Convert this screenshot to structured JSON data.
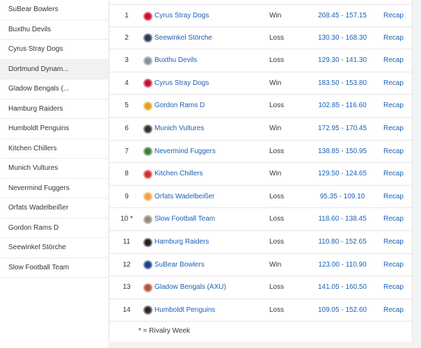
{
  "sidebar": {
    "items": [
      {
        "label": "SuBear Bowlers"
      },
      {
        "label": "Buxthu Devils"
      },
      {
        "label": "Cyrus Stray Dogs"
      },
      {
        "label": "Dortmund Dynam..."
      },
      {
        "label": "Gladow Bengals (..."
      },
      {
        "label": "Hamburg Raiders"
      },
      {
        "label": "Humboldt Penguins"
      },
      {
        "label": "Kitchen Chillers"
      },
      {
        "label": "Munich Vultures"
      },
      {
        "label": "Nevermind Fuggers"
      },
      {
        "label": "Orfats Wadelbeißer"
      },
      {
        "label": "Gordon Rams D"
      },
      {
        "label": "Seewinkel Störche"
      },
      {
        "label": "Slow Football Team"
      }
    ],
    "active_index": 3
  },
  "schedule": {
    "rows": [
      {
        "week": "1",
        "team": "Cyrus Stray Dogs",
        "result": "Win",
        "score": "208.45 - 157.15",
        "recap": "Recap",
        "logo_color": "#c8102e",
        "logo_icon": "cyrus-logo-icon"
      },
      {
        "week": "2",
        "team": "Seewinkel Störche",
        "result": "Loss",
        "score": "130.30 - 168.30",
        "recap": "Recap",
        "logo_color": "#2b3a55",
        "logo_icon": "seewinkel-logo-icon"
      },
      {
        "week": "3",
        "team": "Buxthu Devils",
        "result": "Loss",
        "score": "129.30 - 141.30",
        "recap": "Recap",
        "logo_color": "#8a8f99",
        "logo_icon": "buxthu-logo-icon"
      },
      {
        "week": "4",
        "team": "Cyrus Stray Dogs",
        "result": "Win",
        "score": "183.50 - 153.80",
        "recap": "Recap",
        "logo_color": "#c8102e",
        "logo_icon": "cyrus-logo-icon"
      },
      {
        "week": "5",
        "team": "Gordon Rams D",
        "result": "Loss",
        "score": "102.85 - 116.60",
        "recap": "Recap",
        "logo_color": "#e0a020",
        "logo_icon": "gordon-logo-icon"
      },
      {
        "week": "6",
        "team": "Munich Vultures",
        "result": "Win",
        "score": "172.95 - 170.45",
        "recap": "Recap",
        "logo_color": "#333333",
        "logo_icon": "munich-logo-icon"
      },
      {
        "week": "7",
        "team": "Nevermind Fuggers",
        "result": "Loss",
        "score": "138.85 - 150.95",
        "recap": "Recap",
        "logo_color": "#3f7d3a",
        "logo_icon": "nevermind-logo-icon"
      },
      {
        "week": "8",
        "team": "Kitchen Chillers",
        "result": "Win",
        "score": "129.50 - 124.65",
        "recap": "Recap",
        "logo_color": "#d22f2f",
        "logo_icon": "kitchen-logo-icon"
      },
      {
        "week": "9",
        "team": "Orfats Wadelbeißer",
        "result": "Loss",
        "score": "95.35 - 109.10",
        "recap": "Recap",
        "logo_color": "#f0a040",
        "logo_icon": "orfats-logo-icon"
      },
      {
        "week": "10 *",
        "team": "Slow Football Team",
        "result": "Loss",
        "score": "118.60 - 138.45",
        "recap": "Recap",
        "logo_color": "#9a8a7a",
        "logo_icon": "slow-logo-icon"
      },
      {
        "week": "11",
        "team": "Hamburg Raiders",
        "result": "Loss",
        "score": "110.80 - 152.65",
        "recap": "Recap",
        "logo_color": "#222222",
        "logo_icon": "hamburg-logo-icon"
      },
      {
        "week": "12",
        "team": "SuBear Bowlers",
        "result": "Win",
        "score": "123.00 - 110.90",
        "recap": "Recap",
        "logo_color": "#1d3f8f",
        "logo_icon": "subear-logo-icon"
      },
      {
        "week": "13",
        "team": "Gladow Bengals (AXU)",
        "result": "Loss",
        "score": "141.05 - 160.50",
        "recap": "Recap",
        "logo_color": "#b5543a",
        "logo_icon": "gladow-logo-icon"
      },
      {
        "week": "14",
        "team": "Humboldt Penguins",
        "result": "Loss",
        "score": "109.05 - 152.60",
        "recap": "Recap",
        "logo_color": "#2a2a2a",
        "logo_icon": "humboldt-logo-icon"
      }
    ]
  },
  "footnote": "* = Rivalry Week",
  "colors": {
    "link": "#1a5fb4",
    "text": "#333333",
    "active_bg": "#f2f2f2"
  }
}
